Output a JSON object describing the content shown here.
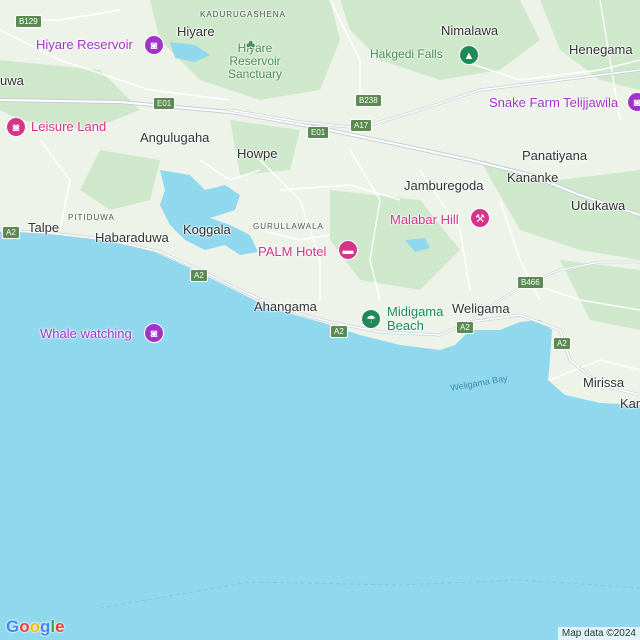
{
  "map": {
    "colors": {
      "land": "#eef3ea",
      "forest": "#cfe8cc",
      "water": "#8fd8ee",
      "road": "#ffffff",
      "highway": "#c5cfd6",
      "poi_pink": "#d6338a",
      "poi_purple": "#a333c8",
      "poi_green": "#1e8a5a"
    },
    "towns": {
      "hiyare": "Hiyare",
      "nimalawa": "Nimalawa",
      "henegama": "Henegama",
      "uwa": "uwa",
      "angulugaha": "Angulugaha",
      "howpe": "Howpe",
      "panatiyana": "Panatiyana",
      "jamburegoda": "Jamburegoda",
      "kananke": "Kananke",
      "udukawa": "Udukawa",
      "talpe": "Talpe",
      "habaraduwa": "Habaraduwa",
      "koggala": "Koggala",
      "ahangama": "Ahangama",
      "weligama": "Weligama",
      "mirissa": "Mirissa",
      "kan": "Kan"
    },
    "localities": {
      "kadurugashena": "KADURUGASHENA",
      "pitiduwa": "PITIDUWA",
      "gurullawala": "GURULLAWALA"
    },
    "parks": {
      "sanctuary_line1": "Hiyare",
      "sanctuary_line2": "Reservoir",
      "sanctuary_line3": "Sanctuary",
      "hakgedi_falls": "Hakgedi Falls"
    },
    "water_labels": {
      "weligama_bay": "Weligama Bay"
    },
    "pois": {
      "hiyare_reservoir": "Hiyare Reservoir",
      "leisure_land": "Leisure Land",
      "snake_farm": "Snake Farm Telijjawila",
      "malabar_hill": "Malabar Hill",
      "palm_hotel": "PALM Hotel",
      "whale_watching": "Whale watching",
      "midigama_line1": "Midigama",
      "midigama_line2": "Beach"
    },
    "road_shields": {
      "b129": "B129",
      "e01_a": "E01",
      "e01_b": "E01",
      "b238": "B238",
      "a17": "A17",
      "a2_talpe": "A2",
      "a2_koggala": "A2",
      "a2_ahangama": "A2",
      "a2_weligama": "A2",
      "a2_east": "A2",
      "b466": "B466"
    },
    "icons": {
      "camera": "camera-icon",
      "bed": "hotel-icon",
      "mountain": "hiking-icon",
      "tree": "park-icon",
      "beach": "beach-icon"
    },
    "logo": {
      "letters": [
        "G",
        "o",
        "o",
        "g",
        "l",
        "e"
      ],
      "colors": [
        "#4285f4",
        "#ea4335",
        "#fbbc05",
        "#4285f4",
        "#34a853",
        "#ea4335"
      ]
    },
    "attribution": "Map data ©2024"
  }
}
